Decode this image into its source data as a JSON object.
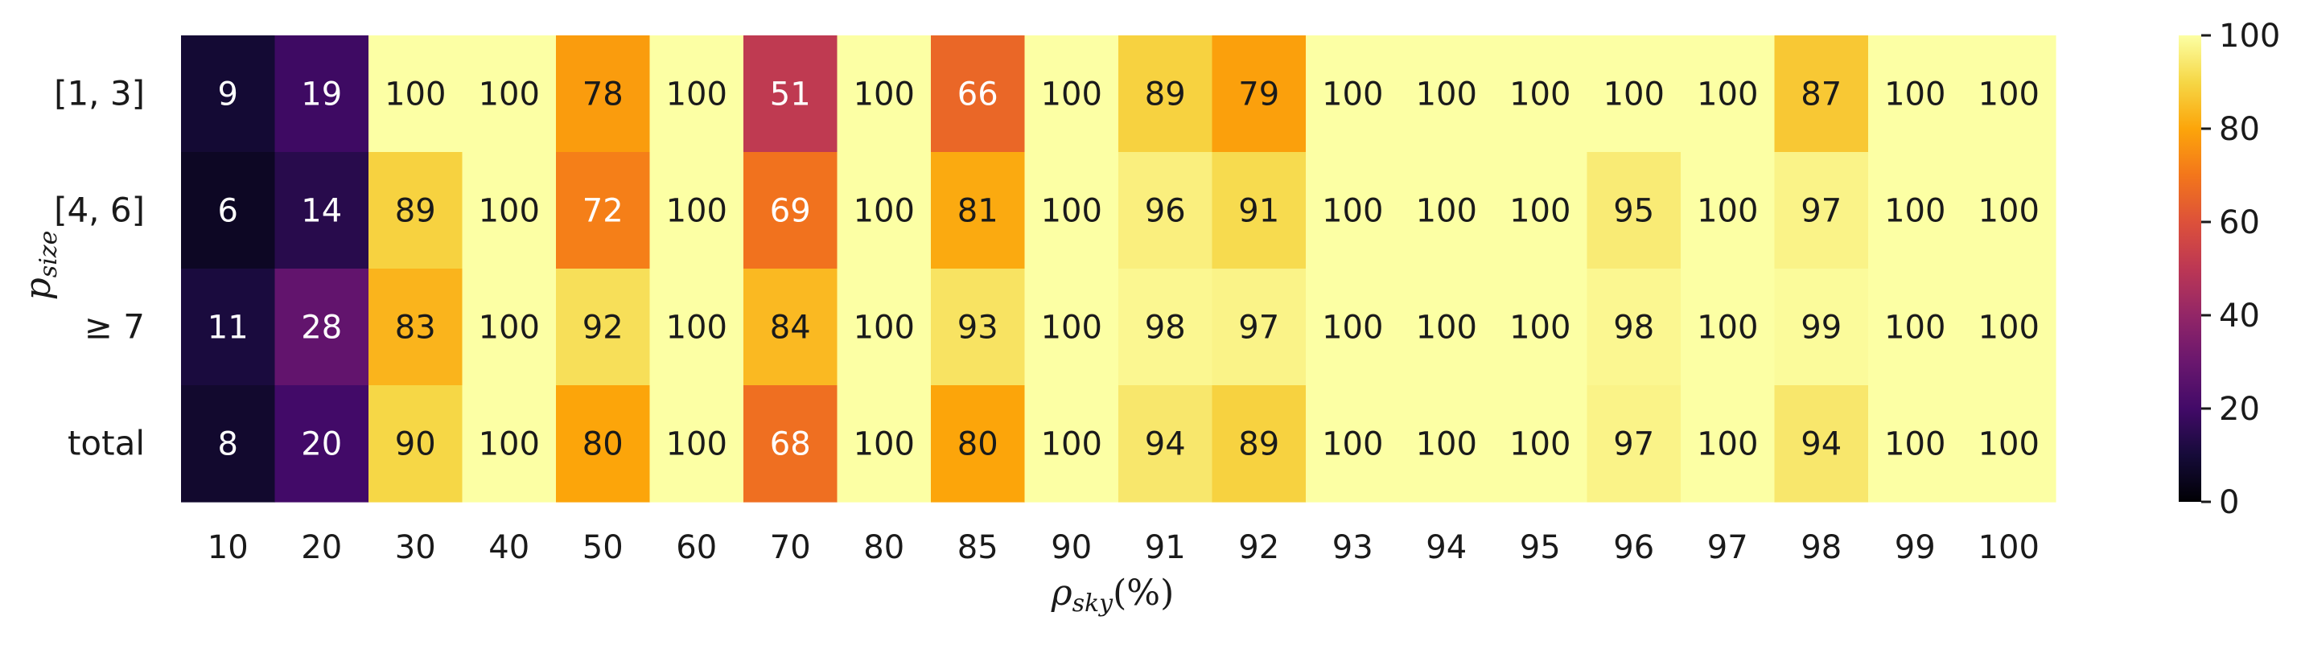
{
  "chart_data": {
    "type": "heatmap",
    "title": "",
    "xlabel": {
      "base": "ρ",
      "sub": "sky",
      "suffix": "(%)"
    },
    "ylabel": {
      "base": "p",
      "sub": "size"
    },
    "x_categories": [
      "10",
      "20",
      "30",
      "40",
      "50",
      "60",
      "70",
      "80",
      "85",
      "90",
      "91",
      "92",
      "93",
      "94",
      "95",
      "96",
      "97",
      "98",
      "99",
      "100"
    ],
    "y_categories": [
      "[1, 3]",
      "[4, 6]",
      "≥ 7",
      "total"
    ],
    "values": [
      [
        9,
        19,
        100,
        100,
        78,
        100,
        51,
        100,
        66,
        100,
        89,
        79,
        100,
        100,
        100,
        100,
        100,
        87,
        100,
        100
      ],
      [
        6,
        14,
        89,
        100,
        72,
        100,
        69,
        100,
        81,
        100,
        96,
        91,
        100,
        100,
        100,
        95,
        100,
        97,
        100,
        100
      ],
      [
        11,
        28,
        83,
        100,
        92,
        100,
        84,
        100,
        93,
        100,
        98,
        97,
        100,
        100,
        100,
        98,
        100,
        99,
        100,
        100
      ],
      [
        8,
        20,
        90,
        100,
        80,
        100,
        68,
        100,
        80,
        100,
        94,
        89,
        100,
        100,
        100,
        97,
        100,
        94,
        100,
        100
      ]
    ],
    "colorscale": "inferno",
    "vmin": 0,
    "vmax": 100,
    "colorbar_ticks": [
      "0",
      "20",
      "40",
      "60",
      "80",
      "100"
    ],
    "annotations": true,
    "grid": false,
    "colorbar_position": "right"
  }
}
